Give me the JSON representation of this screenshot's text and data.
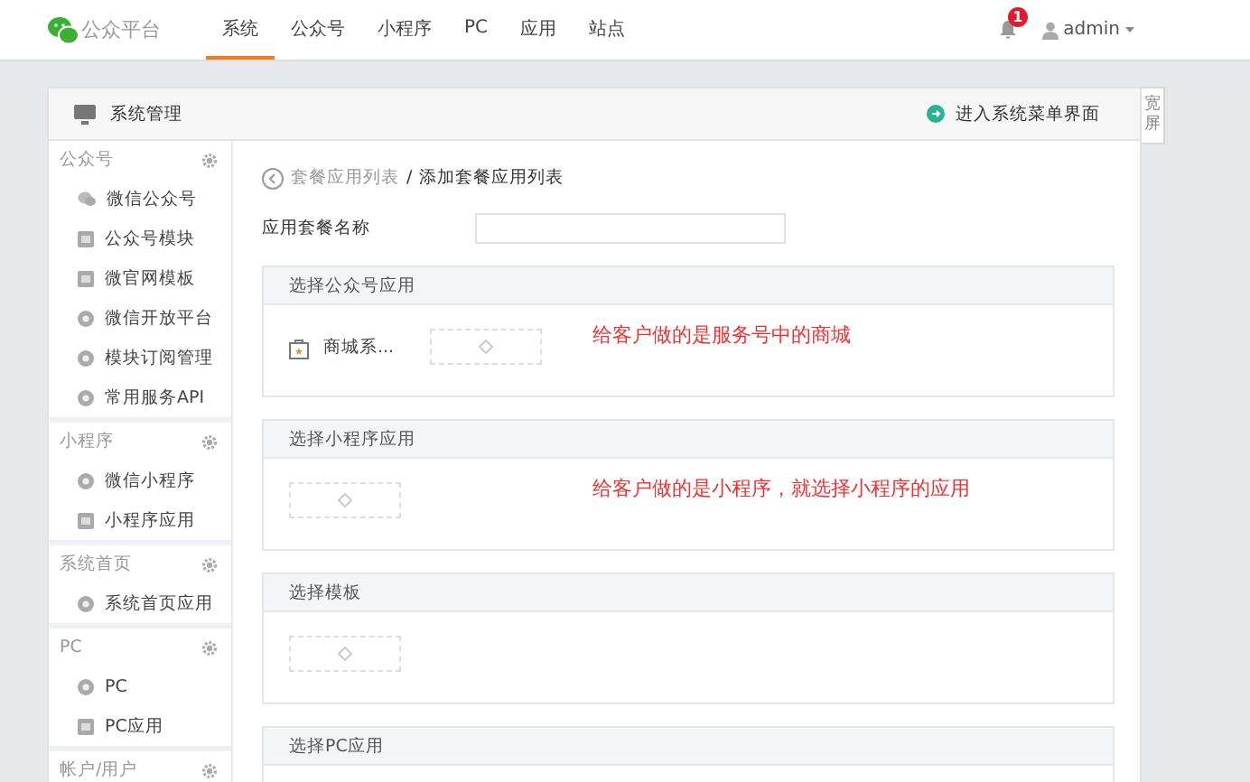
{
  "header": {
    "logo_text": "公众平台",
    "nav": [
      {
        "label": "系统",
        "selected": true
      },
      {
        "label": "公众号",
        "selected": false
      },
      {
        "label": "小程序",
        "selected": false
      },
      {
        "label": "PC",
        "selected": false
      },
      {
        "label": "应用",
        "selected": false
      },
      {
        "label": "站点",
        "selected": false
      }
    ],
    "notification_count": "1",
    "user": "admin"
  },
  "panel": {
    "title": "系统管理",
    "menu_link": "进入系统菜单界面",
    "wide_toggle": "宽屏"
  },
  "sidebar": {
    "groups": [
      {
        "title": "公众号",
        "items": [
          {
            "label": "微信公众号",
            "kind": "chat"
          },
          {
            "label": "公众号模块",
            "kind": "box"
          },
          {
            "label": "微官网模板",
            "kind": "box"
          },
          {
            "label": "微信开放平台",
            "kind": "circle"
          },
          {
            "label": "模块订阅管理",
            "kind": "circle"
          },
          {
            "label": "常用服务API",
            "kind": "circle"
          }
        ]
      },
      {
        "title": "小程序",
        "items": [
          {
            "label": "微信小程序",
            "kind": "circle"
          },
          {
            "label": "小程序应用",
            "kind": "box"
          }
        ]
      },
      {
        "title": "系统首页",
        "items": [
          {
            "label": "系统首页应用",
            "kind": "circle"
          }
        ]
      },
      {
        "title": "PC",
        "items": [
          {
            "label": "PC",
            "kind": "circle"
          },
          {
            "label": "PC应用",
            "kind": "box"
          }
        ]
      },
      {
        "title": "帐户/用户"
      }
    ]
  },
  "content": {
    "breadcrumb": {
      "parent": "套餐应用列表",
      "separator": "/",
      "current": "添加套餐应用列表"
    },
    "name_field": {
      "label": "应用套餐名称"
    },
    "sections": [
      {
        "title": "选择公众号应用",
        "apps": [
          {
            "label": "商城系..."
          }
        ],
        "note": "给客户做的是服务号中的商城"
      },
      {
        "title": "选择小程序应用",
        "note": "给客户做的是小程序，就选择小程序的应用"
      },
      {
        "title": "选择模板"
      },
      {
        "title": "选择PC应用"
      }
    ]
  }
}
